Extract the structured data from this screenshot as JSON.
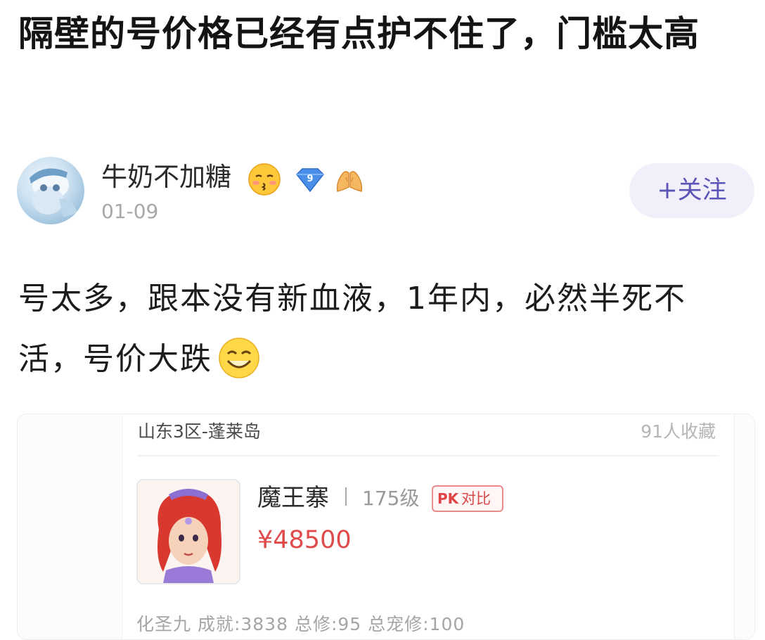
{
  "post": {
    "title": "隔壁的号价格已经有点护不住了，门槛太高",
    "body": "号太多，跟本没有新血液，1年内，必然半死不活，号价大跌"
  },
  "author": {
    "name": "牛奶不加糖",
    "date": "01-09",
    "follow_label": "+关注",
    "badge_level": "9"
  },
  "listing": {
    "server": "山东3区-蓬莱岛",
    "favorites": "91人收藏",
    "character_name": "魔王寨",
    "level": "175级",
    "compare_tag": "PK",
    "compare_label": "对比",
    "price": "¥48500",
    "stats": "化圣九 成就:3838 总修:95 总宠修:100"
  },
  "colors": {
    "accent": "#5b55b8",
    "price": "#e04a4a",
    "follow_bg": "#f1eff9"
  }
}
